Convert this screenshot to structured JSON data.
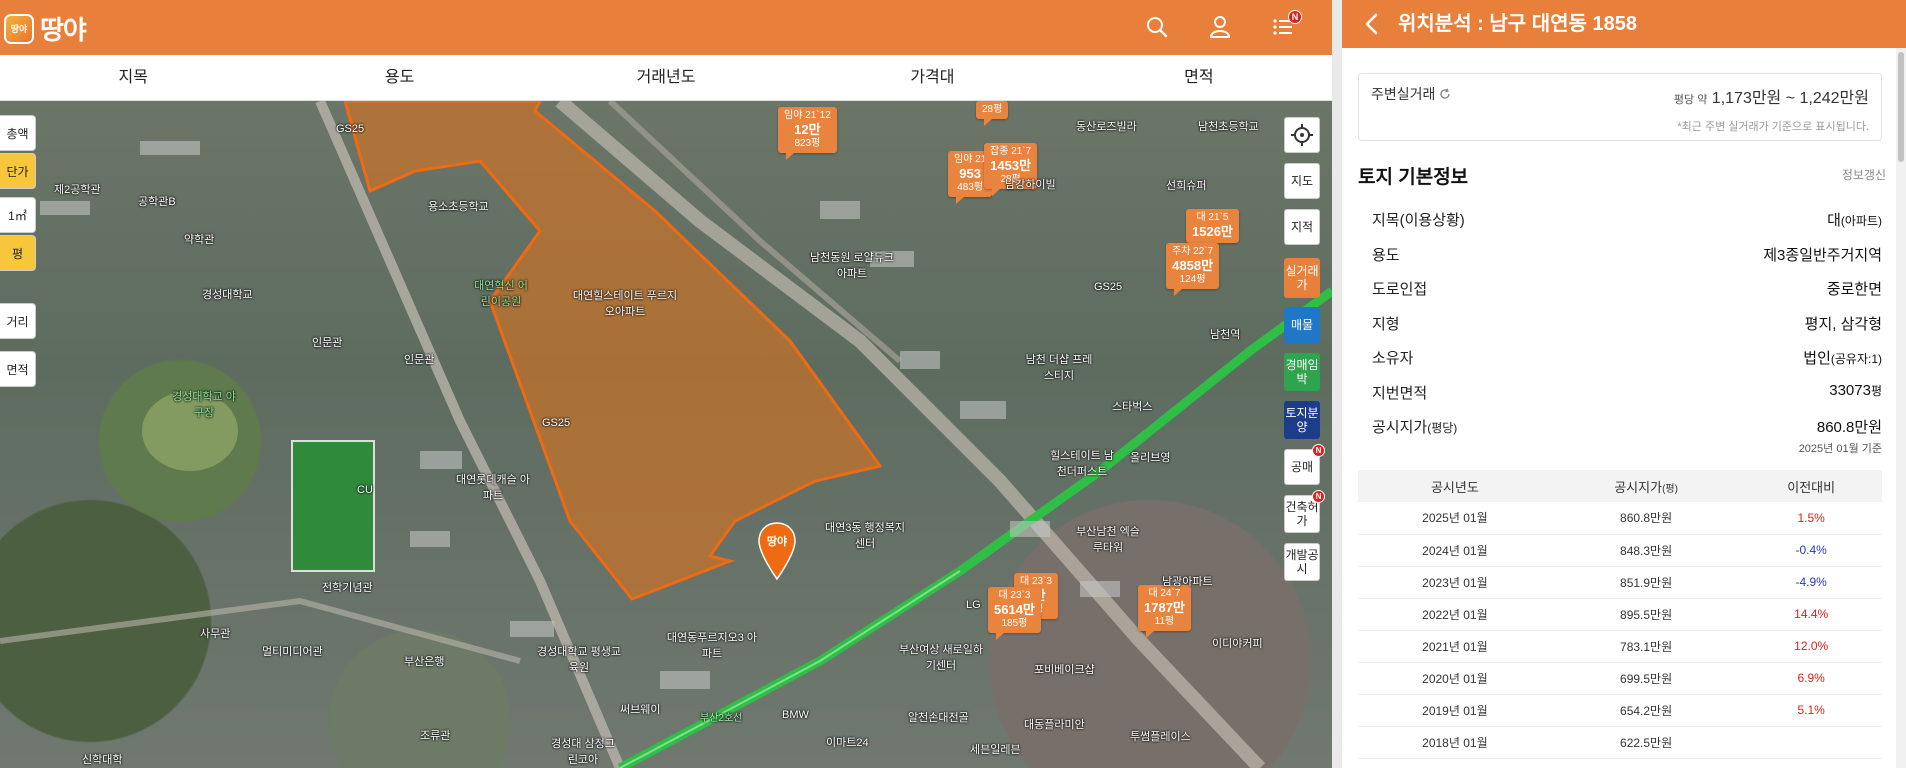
{
  "brand": {
    "name": "땅야",
    "badge": "땅야",
    "color": "#e87f3a"
  },
  "topbar": {
    "search_icon": "search-icon",
    "user_icon": "user-icon",
    "menu_icon": "menu-icon",
    "notification_badge": "N"
  },
  "filters": [
    "지목",
    "용도",
    "거래년도",
    "가격대",
    "면적"
  ],
  "left_controls": {
    "total": "총액",
    "unit": "단가",
    "sqm": "1㎡",
    "pyeong": "평",
    "distance": "거리",
    "area": "면적"
  },
  "right_tools": {
    "locate_icon": "crosshair-icon",
    "map": "지도",
    "cadastral": "지적",
    "real_trade": "실거래가",
    "listing": "매물",
    "auction": "경매임박",
    "land_sale": "토지분양",
    "public_auction": "공매",
    "building_permit": "건축허가",
    "dev_notice": "개발공시",
    "new_badge": "N"
  },
  "map": {
    "pin_label": "땅야",
    "labels": [
      "용소초등학교",
      "대연힐스테이트 푸르지오아파트",
      "대연혁신 어린이공원",
      "경성대학교",
      "경성대학교 야구장",
      "인문관",
      "대연롯데캐슬 아파트",
      "CU",
      "전학기념관",
      "멀티미디어관",
      "부산은행",
      "경성대학교 평생교육원",
      "대연동푸르지오3 아파트",
      "써브웨이",
      "남천동원 로얄듀크아파트",
      "남강하이빌",
      "동산로즈빌라",
      "남천초등학교",
      "선희슈퍼",
      "남천역",
      "남천 더샵 프레스티지",
      "스타벅스",
      "올리브영",
      "힐스테이트 남천더퍼스트",
      "부산남천 엑슬루타워",
      "남광아파트",
      "대연3동 행정복지센터",
      "부산여상 새로일하기센터",
      "포비베이크샵",
      "이디야커피",
      "BMW",
      "이마트24",
      "알천손대전골",
      "대동플라미안",
      "투썸플레이스",
      "세븐일레븐",
      "신학대학",
      "제2공학관",
      "공학관B",
      "약학관",
      "GS25",
      "GS25",
      "GS25",
      "LG",
      "경성대 삼정그린코아",
      "사무관",
      "조류관",
      "인문관",
      "부산2호선"
    ],
    "price_tags": [
      {
        "type": "임야 21`12",
        "price": "12만",
        "area": "823평"
      },
      {
        "type": "",
        "price": "",
        "area": "28평"
      },
      {
        "type": "임야 21",
        "price": "953",
        "area": "483평"
      },
      {
        "type": "잡종 21`7",
        "price": "1453만",
        "area": "28평"
      },
      {
        "type": "대 21`5",
        "price": "1526만",
        "area": ""
      },
      {
        "type": "주차 22`7",
        "price": "4858만",
        "area": "124평"
      },
      {
        "type": "대 23`3",
        "price": "0만",
        "area": "1평"
      },
      {
        "type": "대 23`3",
        "price": "5614만",
        "area": "185평"
      },
      {
        "type": "대 24`7",
        "price": "1787만",
        "area": "11평"
      }
    ]
  },
  "panel": {
    "title": "위치분석 : 남구 대연동 1858",
    "nearby": {
      "label": "주변실거래",
      "refresh_icon": "refresh-icon",
      "prefix": "평당 약",
      "value": "1,173만원 ~ 1,242만원",
      "note": "*최근 주변 실거래가 기준으로 표시됩니다."
    },
    "section_title": "토지 기본정보",
    "section_link": "정보갱신",
    "rows": [
      {
        "key": "지목(이용상황)",
        "key_small": "",
        "value": "대",
        "value_small": "(아파트)"
      },
      {
        "key": "용도",
        "key_small": "",
        "value": "제3종일반주거지역",
        "value_small": ""
      },
      {
        "key": "도로인접",
        "key_small": "",
        "value": "중로한면",
        "value_small": ""
      },
      {
        "key": "지형",
        "key_small": "",
        "value": "평지, 삼각형",
        "value_small": ""
      },
      {
        "key": "소유자",
        "key_small": "",
        "value": "법인",
        "value_small": "(공유자:1)"
      },
      {
        "key": "지번면적",
        "key_small": "",
        "value": "33073",
        "value_small": "평"
      },
      {
        "key": "공시지가",
        "key_small": "(평당)",
        "value": "860.8만원",
        "value_small": ""
      }
    ],
    "base_note": "2025년 01월 기준",
    "table": {
      "headers": [
        "공시년도",
        "공시지가",
        "이전대비"
      ],
      "header_unit": "(평)",
      "rows": [
        {
          "year": "2025년 01월",
          "price": "860.8만원",
          "change": "1.5%",
          "dir": "up"
        },
        {
          "year": "2024년 01월",
          "price": "848.3만원",
          "change": "-0.4%",
          "dir": "down"
        },
        {
          "year": "2023년 01월",
          "price": "851.9만원",
          "change": "-4.9%",
          "dir": "down"
        },
        {
          "year": "2022년 01월",
          "price": "895.5만원",
          "change": "14.4%",
          "dir": "up"
        },
        {
          "year": "2021년 01월",
          "price": "783.1만원",
          "change": "12.0%",
          "dir": "up"
        },
        {
          "year": "2020년 01월",
          "price": "699.5만원",
          "change": "6.9%",
          "dir": "up"
        },
        {
          "year": "2019년 01월",
          "price": "654.2만원",
          "change": "5.1%",
          "dir": "up"
        },
        {
          "year": "2018년 01월",
          "price": "622.5만원",
          "change": "",
          "dir": ""
        }
      ]
    }
  }
}
